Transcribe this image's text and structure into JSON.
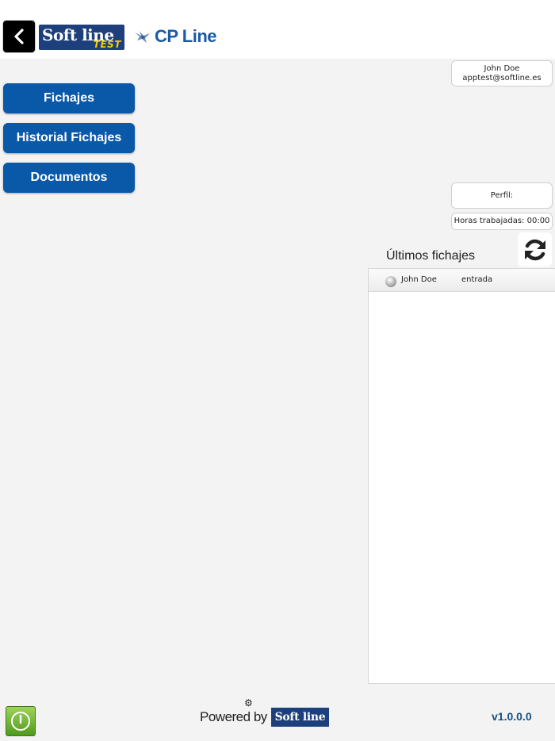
{
  "header": {
    "brand_text": "Soft line",
    "brand_badge": "TEST",
    "app_name": "CP Line"
  },
  "menu": {
    "items": [
      {
        "label": "Fichajes"
      },
      {
        "label": "Historial Fichajes"
      },
      {
        "label": "Documentos"
      }
    ]
  },
  "user": {
    "name": "John Doe",
    "email": "apptest@softline.es"
  },
  "profile": {
    "label": "Perfil:",
    "value": ""
  },
  "hours": {
    "label": "Horas trabajadas: 00:00"
  },
  "recent": {
    "title": "Últimos fichajes",
    "rows": [
      {
        "name": "John Doe",
        "type": "entrada"
      }
    ]
  },
  "footer": {
    "powered_by": "Powered by",
    "powered_brand": "Soft line",
    "version": "v1.0.0.0"
  },
  "colors": {
    "button_blue": "#0a58a8",
    "brand_navy": "#1d3f7b",
    "version_text": "#15507f",
    "power_green": "#4f9a1e"
  },
  "icons": {
    "back": "chevron-left-icon",
    "refresh": "refresh-icon",
    "power": "power-icon",
    "gear": "gear-icon",
    "status": "status-ball-icon"
  }
}
